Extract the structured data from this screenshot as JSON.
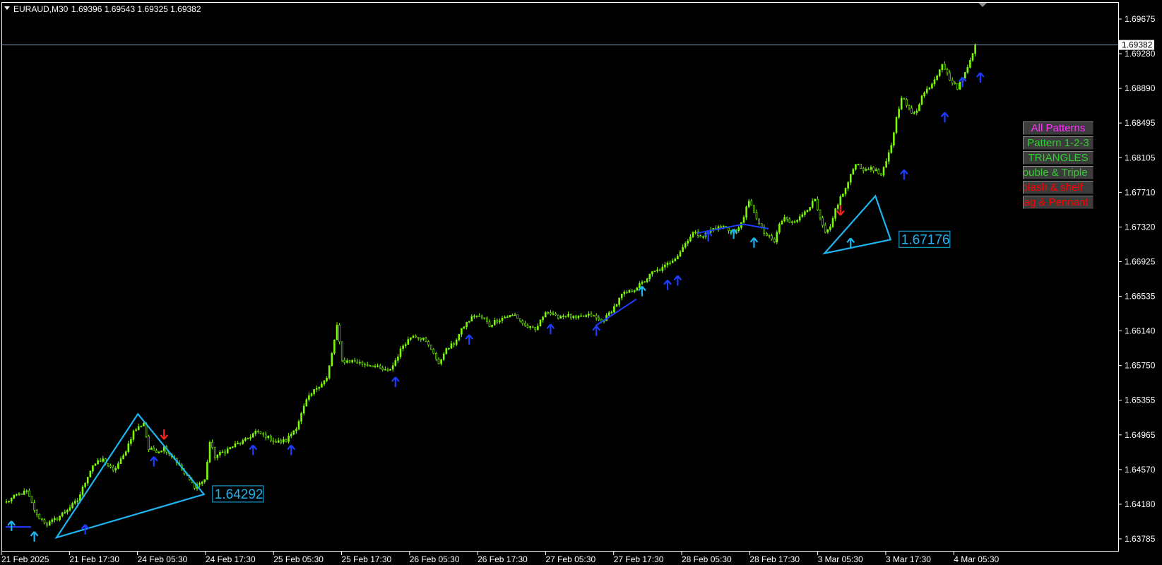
{
  "header": {
    "symbol": "EURAUD,M30",
    "ohlc": "1.69396 1.69543 1.69325 1.69382"
  },
  "price_tag": "1.69382",
  "pattern_labels": [
    "1.64292",
    "1.67176"
  ],
  "panel": {
    "buttons": [
      {
        "label": "All Patterns",
        "color": "#ff33ff"
      },
      {
        "label": "Pattern 1-2-3",
        "color": "#33cc33"
      },
      {
        "label": "TRIANGLES",
        "color": "#33cc33"
      },
      {
        "label": "Double & Triple",
        "color": "#33cc33"
      },
      {
        "label": "Splash & shelf",
        "color": "#ff0000"
      },
      {
        "label": "Flag & Pennant",
        "color": "#ff0000"
      }
    ]
  },
  "colors": {
    "background": "#000000",
    "candle": "#7CFC00",
    "pattern_line": "#1EB4F0",
    "zigzag": "#1E3CFF",
    "arrow_up": "#1E3CFF",
    "arrow_down": "#FF2020",
    "grid_frame": "#FFFFFF",
    "bid_line": "#7B8FA8"
  },
  "chart_data": {
    "type": "candlestick",
    "instrument": "EURAUD",
    "timeframe": "M30",
    "bid": 1.69382,
    "y_ticks": [
      "1.69675",
      "1.69280",
      "1.68890",
      "1.68495",
      "1.68105",
      "1.67710",
      "1.67320",
      "1.66925",
      "1.66535",
      "1.66140",
      "1.65750",
      "1.65355",
      "1.64965",
      "1.64570",
      "1.64180",
      "1.63785"
    ],
    "ylim": [
      1.63785,
      1.69675
    ],
    "x_ticks": [
      "21 Feb 2025",
      "21 Feb 17:30",
      "24 Feb 05:30",
      "24 Feb 17:30",
      "25 Feb 05:30",
      "25 Feb 17:30",
      "26 Feb 05:30",
      "26 Feb 17:30",
      "27 Feb 05:30",
      "27 Feb 17:30",
      "28 Feb 05:30",
      "28 Feb 17:30",
      "3 Mar 05:30",
      "3 Mar 17:30",
      "4 Mar 05:30"
    ],
    "close_path": [
      [
        0,
        1.642
      ],
      [
        4,
        1.6428
      ],
      [
        8,
        1.6432
      ],
      [
        12,
        1.6405
      ],
      [
        16,
        1.6395
      ],
      [
        20,
        1.6402
      ],
      [
        24,
        1.6412
      ],
      [
        28,
        1.6422
      ],
      [
        32,
        1.645
      ],
      [
        34,
        1.6462
      ],
      [
        38,
        1.6468
      ],
      [
        42,
        1.6455
      ],
      [
        46,
        1.6472
      ],
      [
        50,
        1.65
      ],
      [
        54,
        1.651
      ],
      [
        56,
        1.648
      ],
      [
        60,
        1.6478
      ],
      [
        62,
        1.6482
      ],
      [
        66,
        1.647
      ],
      [
        70,
        1.6452
      ],
      [
        74,
        1.6438
      ],
      [
        78,
        1.6445
      ],
      [
        80,
        1.6488
      ],
      [
        82,
        1.6472
      ],
      [
        86,
        1.6478
      ],
      [
        90,
        1.6485
      ],
      [
        94,
        1.649
      ],
      [
        98,
        1.65
      ],
      [
        102,
        1.6495
      ],
      [
        106,
        1.6488
      ],
      [
        110,
        1.649
      ],
      [
        114,
        1.6505
      ],
      [
        118,
        1.6535
      ],
      [
        122,
        1.655
      ],
      [
        126,
        1.656
      ],
      [
        128,
        1.6588
      ],
      [
        130,
        1.662
      ],
      [
        132,
        1.658
      ],
      [
        136,
        1.658
      ],
      [
        140,
        1.6577
      ],
      [
        144,
        1.6575
      ],
      [
        148,
        1.657
      ],
      [
        150,
        1.6568
      ],
      [
        152,
        1.6575
      ],
      [
        156,
        1.6598
      ],
      [
        160,
        1.661
      ],
      [
        164,
        1.6605
      ],
      [
        168,
        1.659
      ],
      [
        170,
        1.6575
      ],
      [
        172,
        1.659
      ],
      [
        176,
        1.66
      ],
      [
        180,
        1.662
      ],
      [
        184,
        1.6632
      ],
      [
        188,
        1.6628
      ],
      [
        190,
        1.662
      ],
      [
        192,
        1.6625
      ],
      [
        196,
        1.663
      ],
      [
        200,
        1.6632
      ],
      [
        204,
        1.662
      ],
      [
        208,
        1.6615
      ],
      [
        210,
        1.6625
      ],
      [
        212,
        1.6637
      ],
      [
        216,
        1.663
      ],
      [
        220,
        1.6632
      ],
      [
        224,
        1.6628
      ],
      [
        226,
        1.663
      ],
      [
        230,
        1.6632
      ],
      [
        234,
        1.6625
      ],
      [
        236,
        1.663
      ],
      [
        240,
        1.6645
      ],
      [
        242,
        1.6655
      ],
      [
        246,
        1.666
      ],
      [
        250,
        1.6668
      ],
      [
        254,
        1.668
      ],
      [
        258,
        1.6685
      ],
      [
        260,
        1.669
      ],
      [
        264,
        1.67
      ],
      [
        268,
        1.6718
      ],
      [
        270,
        1.6725
      ],
      [
        274,
        1.6722
      ],
      [
        278,
        1.673
      ],
      [
        282,
        1.6732
      ],
      [
        286,
        1.6725
      ],
      [
        288,
        1.673
      ],
      [
        290,
        1.6745
      ],
      [
        292,
        1.676
      ],
      [
        294,
        1.675
      ],
      [
        296,
        1.6735
      ],
      [
        298,
        1.6725
      ],
      [
        300,
        1.672
      ],
      [
        302,
        1.6715
      ],
      [
        304,
        1.6735
      ],
      [
        306,
        1.6742
      ],
      [
        308,
        1.6738
      ],
      [
        312,
        1.6742
      ],
      [
        314,
        1.675
      ],
      [
        318,
        1.6762
      ],
      [
        320,
        1.674
      ],
      [
        322,
        1.6725
      ],
      [
        324,
        1.673
      ],
      [
        326,
        1.6752
      ],
      [
        328,
        1.6765
      ],
      [
        330,
        1.6775
      ],
      [
        332,
        1.679
      ],
      [
        334,
        1.6805
      ],
      [
        336,
        1.68
      ],
      [
        338,
        1.6795
      ],
      [
        340,
        1.68
      ],
      [
        342,
        1.6795
      ],
      [
        344,
        1.679
      ],
      [
        346,
        1.6805
      ],
      [
        348,
        1.6825
      ],
      [
        350,
        1.6855
      ],
      [
        352,
        1.688
      ],
      [
        354,
        1.687
      ],
      [
        356,
        1.686
      ],
      [
        358,
        1.6865
      ],
      [
        360,
        1.688
      ],
      [
        364,
        1.6895
      ],
      [
        366,
        1.6905
      ],
      [
        368,
        1.6918
      ],
      [
        370,
        1.6905
      ],
      [
        372,
        1.6895
      ],
      [
        374,
        1.689
      ],
      [
        376,
        1.69
      ],
      [
        378,
        1.6915
      ],
      [
        380,
        1.693
      ],
      [
        381,
        1.6938
      ]
    ],
    "patterns": [
      {
        "type": "triangle",
        "points": [
          [
            20,
            1.638
          ],
          [
            52,
            1.652
          ],
          [
            78,
            1.6429
          ]
        ],
        "label": "1.64292"
      },
      {
        "type": "triangle",
        "points": [
          [
            322,
            1.6702
          ],
          [
            342,
            1.6767
          ],
          [
            348,
            1.67176
          ]
        ],
        "label": "1.67176"
      }
    ],
    "zigzag": [
      [
        [
          0,
          1.6392
        ],
        [
          10,
          1.6392
        ]
      ],
      [
        [
          232,
          1.662
        ],
        [
          248,
          1.665
        ]
      ],
      [
        [
          272,
          1.6725
        ],
        [
          290,
          1.6735
        ]
      ],
      [
        [
          290,
          1.6735
        ],
        [
          300,
          1.673
        ]
      ]
    ],
    "arrows_up": [
      [
        2,
        1.6397,
        "cyan"
      ],
      [
        11,
        1.6385,
        "cyan"
      ],
      [
        31,
        1.6393,
        "blue"
      ],
      [
        58,
        1.647,
        "blue"
      ],
      [
        97,
        1.6483,
        "blue"
      ],
      [
        112,
        1.6483,
        "blue"
      ],
      [
        153,
        1.656,
        "blue"
      ],
      [
        182,
        1.6608,
        "blue"
      ],
      [
        214,
        1.662,
        "blue"
      ],
      [
        232,
        1.6618,
        "blue"
      ],
      [
        250,
        1.6663,
        "cyan"
      ],
      [
        260,
        1.667,
        "blue"
      ],
      [
        264,
        1.6675,
        "blue"
      ],
      [
        276,
        1.6725,
        "blue"
      ],
      [
        286,
        1.6728,
        "cyan"
      ],
      [
        294,
        1.6718,
        "cyan"
      ],
      [
        332,
        1.67176,
        "cyan"
      ],
      [
        353,
        1.6795,
        "blue"
      ],
      [
        369,
        1.686,
        "blue"
      ],
      [
        376,
        1.69,
        "blue"
      ],
      [
        383,
        1.6905,
        "blue"
      ]
    ],
    "arrows_down": [
      [
        62,
        1.6493
      ],
      [
        328,
        1.6747
      ]
    ]
  }
}
